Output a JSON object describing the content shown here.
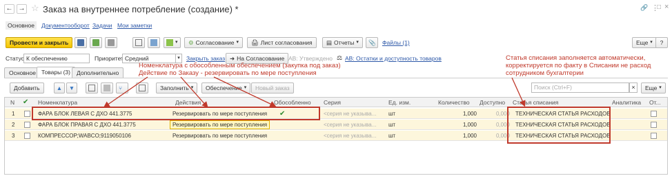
{
  "window": {
    "title": "Заказ на внутреннее потребление (создание) *"
  },
  "nav_tabs": [
    "Основное",
    "Документооборот",
    "Задачи",
    "Мои заметки"
  ],
  "toolbar": {
    "post_close": "Провести и закрыть",
    "approval": "Согласование",
    "approval_sheet": "Лист согласования",
    "reports": "Отчеты",
    "files": "Файлы (1)",
    "more": "Еще",
    "help": "?"
  },
  "status_line": {
    "status_label": "Статус:",
    "status_value": "К обеспечению",
    "priority_label": "Приоритет:",
    "priority_value": "Средний",
    "close_order": "Закрыть заказ",
    "to_approval": "На Согласование",
    "approved": "АВ: Утверждено",
    "balances": "АВ: Остатки и доступность товаров"
  },
  "doc_tabs": [
    "Основное",
    "Товары (3)",
    "Дополнительно"
  ],
  "table_toolbar": {
    "add": "Добавить",
    "fill": "Заполнить",
    "supply": "Обеспечение",
    "new_order": "Новый заказ",
    "search_placeholder": "Поиск (Ctrl+F)",
    "more": "Еще"
  },
  "columns": [
    "N",
    "Номенклатура",
    "Действия",
    "Обособленно",
    "Серия",
    "Ед. изм.",
    "Количество",
    "Доступно",
    "Статья списания",
    "Аналитика",
    "От..."
  ],
  "rows": [
    {
      "n": "1",
      "item": "ФАРА БЛОК ЛЕВАЯ С ДХО 441.3775",
      "action": "Резервировать по мере поступления",
      "separate": "✔",
      "series": "<серия не указыва...",
      "unit": "шт",
      "qty": "1,000",
      "avail": "0,000",
      "article": "ТЕХНИЧЕСКАЯ СТАТЬЯ РАСХОДОВ"
    },
    {
      "n": "2",
      "item": "ФАРА БЛОК ПРАВАЯ С ДХО 441.3775",
      "action": "Резервировать по мере поступления",
      "separate": "",
      "series": "<серия не указыва...",
      "unit": "шт",
      "qty": "1,000",
      "avail": "0,000",
      "article": "ТЕХНИЧЕСКАЯ СТАТЬЯ РАСХОДОВ"
    },
    {
      "n": "3",
      "item": "КОМПРЕССОР;WABCO;9119050106",
      "action": "Резервировать по мере поступления",
      "separate": "",
      "series": "<серия не указыва...",
      "unit": "шт",
      "qty": "1,000",
      "avail": "0,000",
      "article": "ТЕХНИЧЕСКАЯ СТАТЬЯ РАСХОДОВ"
    }
  ],
  "annotations": {
    "left_1": "Номенклатура с обособленным обеспечением (закупка под заказ)",
    "left_2": "Действие по Заказу - резервировать по мере поступления",
    "right_1": "Статья списания  заполняется автоматически,",
    "right_2": "корректируется по факту в Списании не расход",
    "right_3": "сотрудником бухгалтерии"
  },
  "colors": {
    "accent_yellow": "#f4c400",
    "annotation_red": "#c0392b",
    "row_highlight": "#fdf6dc"
  }
}
